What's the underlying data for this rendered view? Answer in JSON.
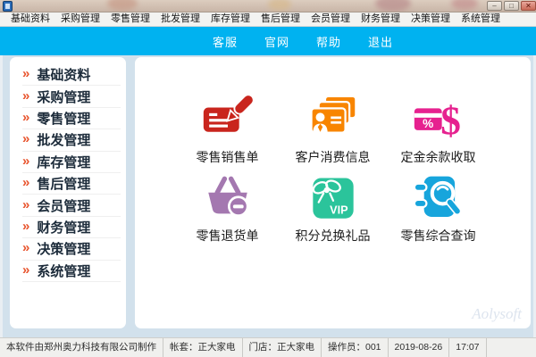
{
  "window": {
    "controls": {
      "minimize": "–",
      "maximize": "□",
      "close": "✕"
    }
  },
  "menu_bar": {
    "items": [
      "基础资料",
      "采购管理",
      "零售管理",
      "批发管理",
      "库存管理",
      "售后管理",
      "会员管理",
      "财务管理",
      "决策管理",
      "系统管理"
    ]
  },
  "toolbar": {
    "bg_color": "#00b2f0",
    "links": [
      "客服",
      "官网",
      "帮助",
      "退出"
    ]
  },
  "sidebar": {
    "chevron": "»",
    "chevron_color": "#e8532c",
    "items": [
      "基础资料",
      "采购管理",
      "零售管理",
      "批发管理",
      "库存管理",
      "售后管理",
      "会员管理",
      "财务管理",
      "决策管理",
      "系统管理"
    ]
  },
  "main": {
    "shortcuts": [
      {
        "label": "零售销售单",
        "icon": "receipt-pen-icon",
        "color": "#c9251d"
      },
      {
        "label": "客户消费信息",
        "icon": "customer-cards-icon",
        "color": "#f88500"
      },
      {
        "label": "定金余款收取",
        "icon": "card-dollar-icon",
        "color": "#e6218f"
      },
      {
        "label": "零售退货单",
        "icon": "basket-minus-icon",
        "color": "#a478b0"
      },
      {
        "label": "积分兑换礼品",
        "icon": "gift-vip-icon",
        "color": "#2bc49b"
      },
      {
        "label": "零售综合查询",
        "icon": "notebook-search-icon",
        "color": "#17a5dc"
      }
    ],
    "watermark": "Aolysoft"
  },
  "status_bar": {
    "segments": [
      "本软件由郑州奥力科技有限公司制作",
      "帐套：正大家电",
      "门店：正大家电",
      "操作员：001",
      "2019-08-26",
      "17:07"
    ]
  }
}
